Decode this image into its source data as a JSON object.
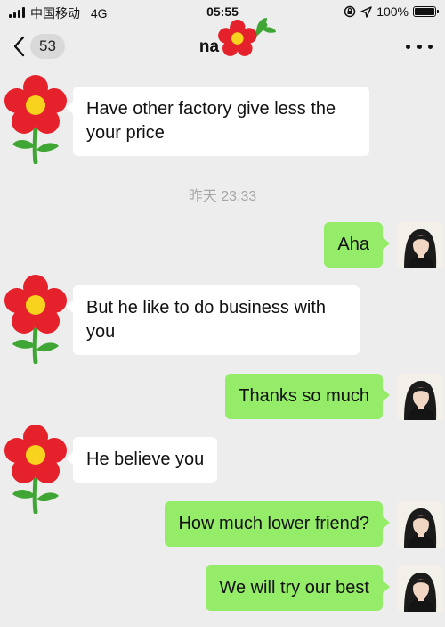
{
  "status_bar": {
    "carrier": "中国移动",
    "network": "4G",
    "time": "05:55",
    "icons": [
      "orientation-lock-icon",
      "location-arrow-icon"
    ],
    "battery": "100%",
    "battery_level": 1.0
  },
  "nav": {
    "back_icon": "chevron-left-icon",
    "unread_count": "53",
    "title": "na",
    "title_decoration": "red-flower-icon",
    "more_icon": "ellipsis-icon"
  },
  "messages": [
    {
      "side": "in",
      "avatar": "red-flower-icon",
      "text_lines": [
        "Have other factory give less the",
        "your price"
      ]
    },
    {
      "side": "timestamp",
      "text": "昨天 23:33"
    },
    {
      "side": "out",
      "avatar": "user-photo-avatar",
      "text_lines": [
        "Aha"
      ]
    },
    {
      "side": "in",
      "avatar": "red-flower-icon",
      "text_lines": [
        "But he like to do business with",
        "you"
      ]
    },
    {
      "side": "out",
      "avatar": "user-photo-avatar",
      "text_lines": [
        "Thanks so much"
      ]
    },
    {
      "side": "in",
      "avatar": "red-flower-icon",
      "text_lines": [
        "He believe you"
      ]
    },
    {
      "side": "out",
      "avatar": "user-photo-avatar",
      "text_lines": [
        "How much lower friend?"
      ]
    },
    {
      "side": "out",
      "avatar": "user-photo-avatar",
      "text_lines": [
        "We will try our best"
      ]
    }
  ],
  "colors": {
    "background": "#ededed",
    "incoming_bubble": "#ffffff",
    "outgoing_bubble": "#95ec69",
    "timestamp_text": "#a6a6a6",
    "flower_petal": "#e5212b",
    "flower_center": "#f7d31e",
    "flower_stem": "#3fa535"
  }
}
